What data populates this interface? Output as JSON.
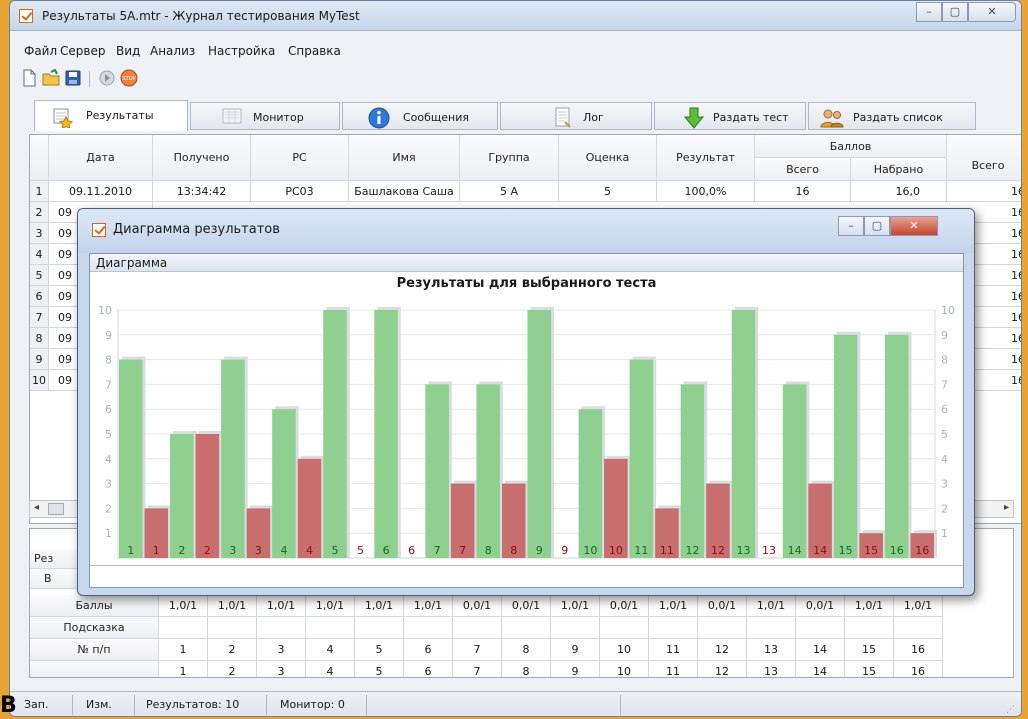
{
  "window": {
    "title": "Результаты 5А.mtr - Журнал тестирования MyTest"
  },
  "menu": [
    "Файл",
    "Сервер",
    "Вид",
    "Анализ",
    "Настройка",
    "Справка"
  ],
  "toolbar_icons": [
    "new-file-icon",
    "open-folder-icon",
    "save-icon",
    "play-icon",
    "stop-icon"
  ],
  "tabs": [
    {
      "label": "Результаты",
      "icon": "results-icon"
    },
    {
      "label": "Монитор",
      "icon": "monitor-icon"
    },
    {
      "label": "Сообщения",
      "icon": "info-icon"
    },
    {
      "label": "Лог",
      "icon": "log-icon"
    },
    {
      "label": "Раздать тест",
      "icon": "download-arrow-icon"
    },
    {
      "label": "Раздать список",
      "icon": "users-icon"
    }
  ],
  "table": {
    "headers": {
      "date": "Дата",
      "received": "Получено",
      "pc": "PC",
      "name": "Имя",
      "group": "Группа",
      "grade": "Оценка",
      "result": "Результат",
      "points": "Баллов",
      "total": "Всего",
      "scored": "Набрано",
      "total2": "Всего"
    },
    "row_numbers": [
      "1",
      "2",
      "3",
      "4",
      "5",
      "6",
      "7",
      "8",
      "9",
      "10"
    ],
    "first_row": {
      "date": "09.11.2010",
      "received": "13:34:42",
      "pc": "PC03",
      "name": "Башлакова Саша",
      "group": "5 А",
      "grade": "5",
      "result": "100,0%",
      "total": "16",
      "scored": "16,0",
      "total2": "16"
    },
    "row_prefixes": [
      "09",
      "09",
      "09",
      "09",
      "09",
      "09",
      "09",
      "09",
      "09"
    ],
    "last_column": [
      "16",
      "16",
      "16",
      "16",
      "16",
      "16",
      "16",
      "16",
      "16",
      "16"
    ]
  },
  "bottom": {
    "row_labels": {
      "res": "Рез",
      "v": "В",
      "points": "Баллы",
      "hint": "Подсказка",
      "num": "№ п/п"
    },
    "points": [
      "1,0/1",
      "1,0/1",
      "1,0/1",
      "1,0/1",
      "1,0/1",
      "1,0/1",
      "0,0/1",
      "0,0/1",
      "1,0/1",
      "0,0/1",
      "1,0/1",
      "0,0/1",
      "1,0/1",
      "0,0/1",
      "1,0/1",
      "1,0/1"
    ],
    "numbers": [
      "1",
      "2",
      "3",
      "4",
      "5",
      "6",
      "7",
      "8",
      "9",
      "10",
      "11",
      "12",
      "13",
      "14",
      "15",
      "16"
    ]
  },
  "status": {
    "zap": "Зап.",
    "izm": "Изм.",
    "results": "Результатов: 10",
    "monitor": "Монитор: 0"
  },
  "stray_letter": "В",
  "dialog": {
    "title": "Диаграмма результатов",
    "menu": "Диаграмма",
    "chart_title": "Результаты для выбранного теста"
  },
  "colors": {
    "correct": "#8fcf8f",
    "wrong": "#c96e6e",
    "correct_label": "#1a6a1a",
    "wrong_label": "#8a1010"
  },
  "chart_data": {
    "type": "bar",
    "title": "Результаты для выбранного теста",
    "ylim": [
      0,
      10
    ],
    "yticks": [
      1,
      2,
      3,
      4,
      5,
      6,
      7,
      8,
      9,
      10
    ],
    "grid": true,
    "categories": [
      "1",
      "2",
      "3",
      "4",
      "5",
      "6",
      "7",
      "8",
      "9",
      "10",
      "11",
      "12",
      "13",
      "14",
      "15",
      "16"
    ],
    "series": [
      {
        "color": "#8fcf8f",
        "values": [
          8,
          5,
          8,
          6,
          10,
          10,
          7,
          7,
          10,
          6,
          8,
          7,
          10,
          7,
          9,
          9
        ]
      },
      {
        "color": "#c96e6e",
        "values": [
          2,
          5,
          2,
          4,
          0,
          0,
          3,
          3,
          0,
          4,
          2,
          3,
          0,
          3,
          1,
          1
        ]
      }
    ]
  }
}
